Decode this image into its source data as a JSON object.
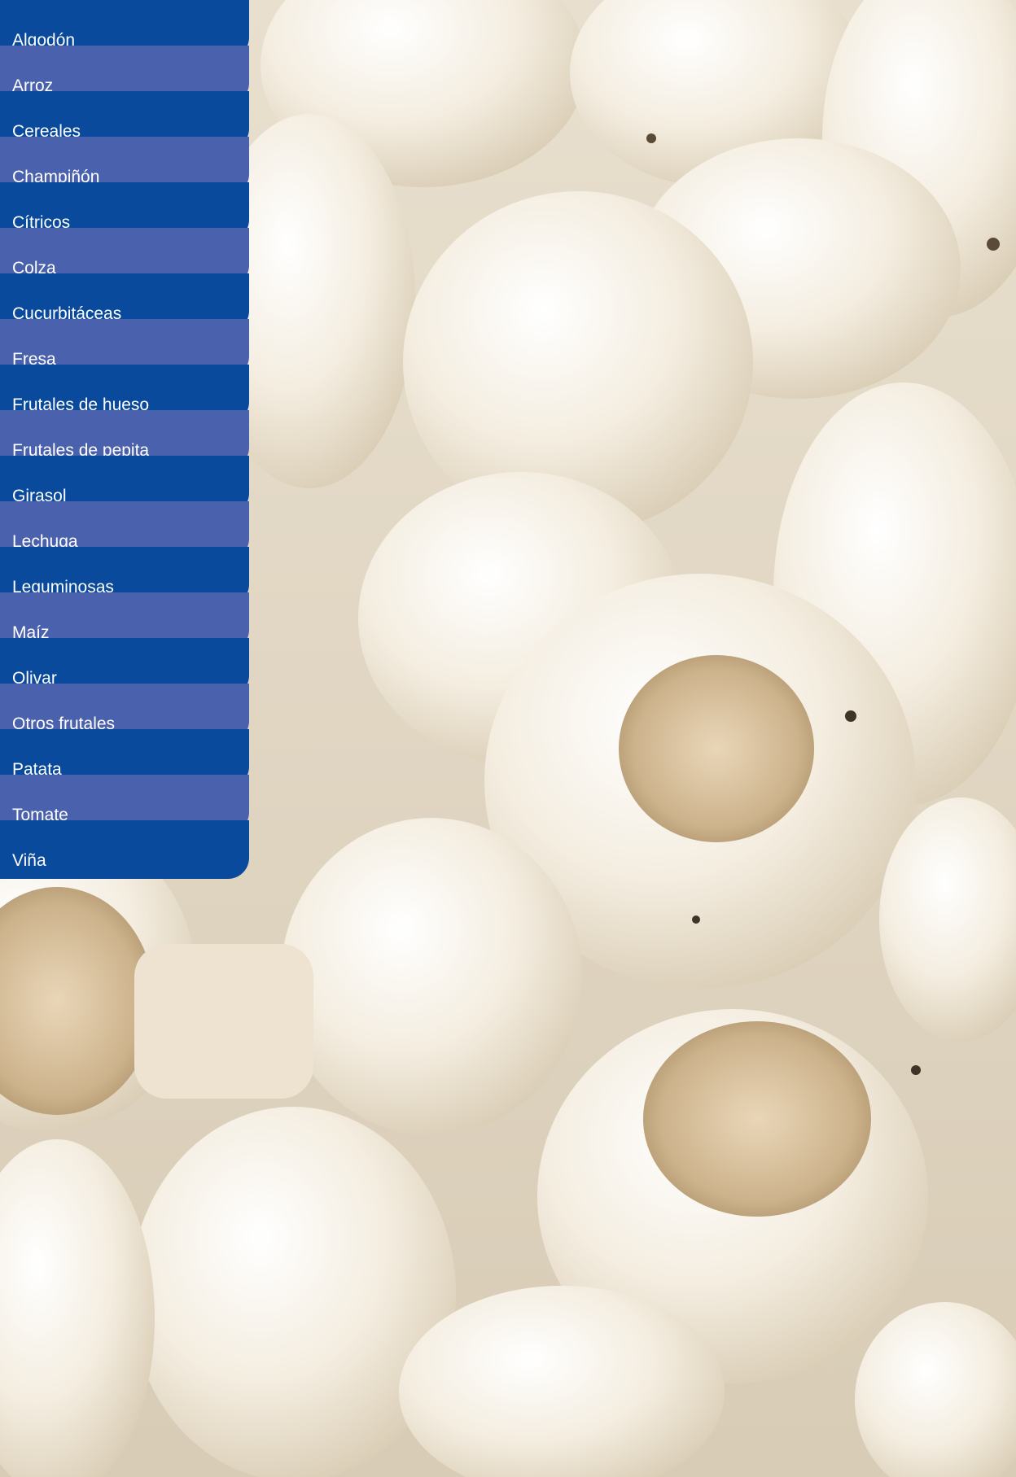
{
  "menu": {
    "items": [
      {
        "label": "Algodón"
      },
      {
        "label": "Arroz"
      },
      {
        "label": "Cereales"
      },
      {
        "label": "Champiñón"
      },
      {
        "label": "Cítricos"
      },
      {
        "label": "Colza"
      },
      {
        "label": "Cucurbitáceas"
      },
      {
        "label": "Fresa"
      },
      {
        "label": "Frutales de hueso"
      },
      {
        "label": "Frutales de pepita"
      },
      {
        "label": "Girasol"
      },
      {
        "label": "Lechuga"
      },
      {
        "label": "Leguminosas"
      },
      {
        "label": "Maíz"
      },
      {
        "label": "Olivar"
      },
      {
        "label": "Otros frutales"
      },
      {
        "label": "Patata"
      },
      {
        "label": "Tomate"
      },
      {
        "label": "Viña"
      }
    ]
  },
  "colors": {
    "menu_dark": "#0a4a9c",
    "menu_light": "#4a62ad",
    "menu_text": "#ffffff"
  },
  "background": {
    "subject": "close-up photo of white button mushrooms"
  }
}
